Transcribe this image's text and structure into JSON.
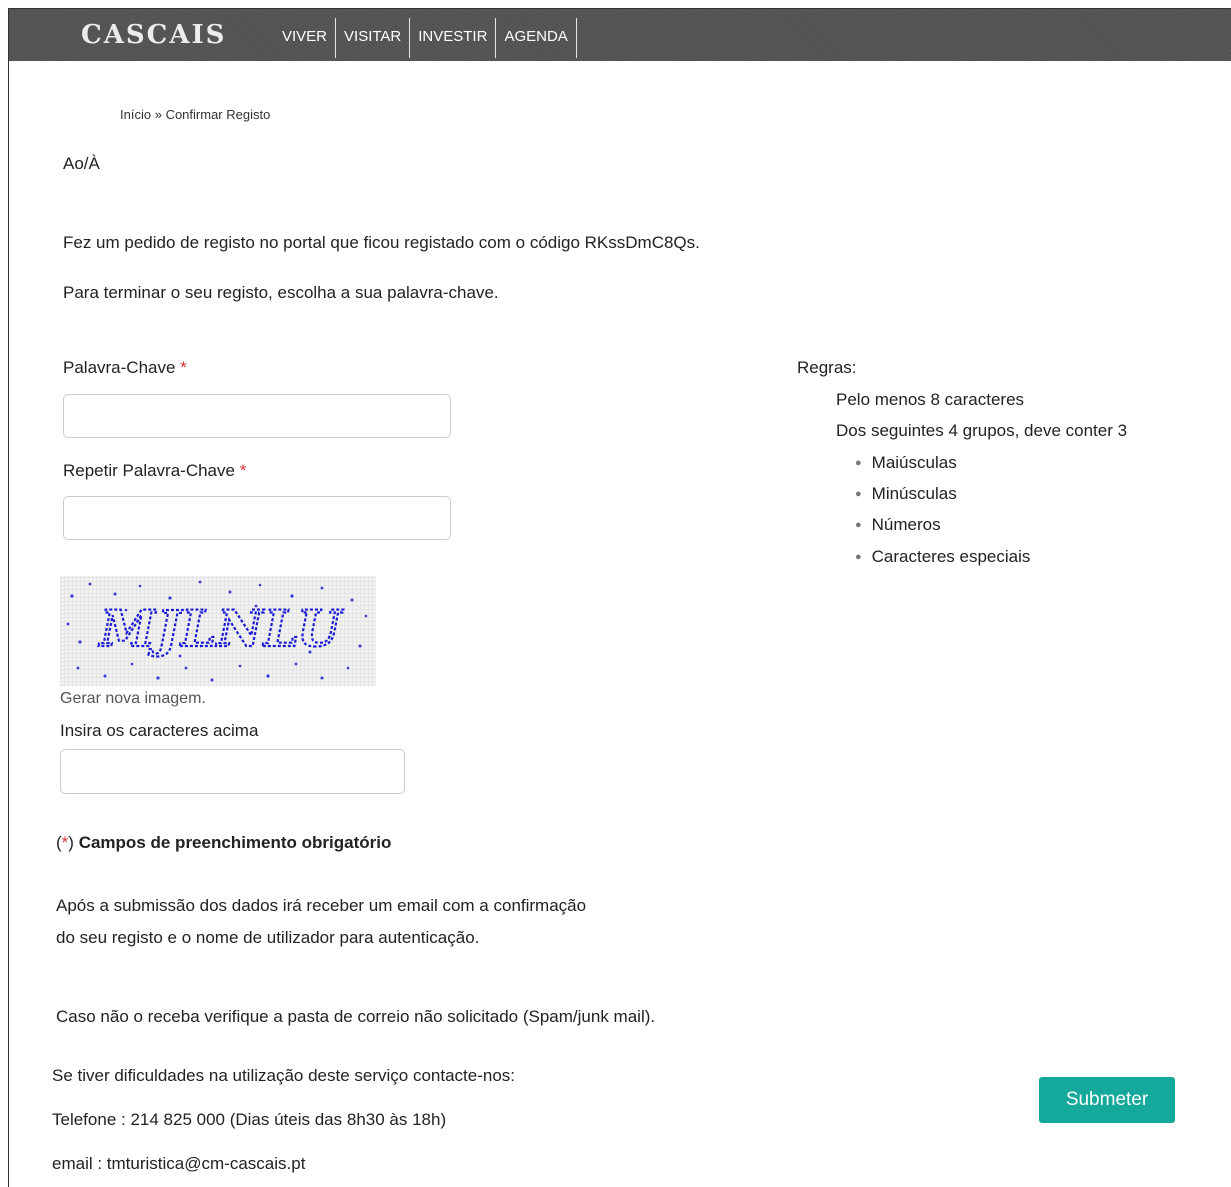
{
  "header": {
    "logo": "CASCAIS",
    "nav": [
      "VIVER",
      "VISITAR",
      "INVESTIR",
      "AGENDA"
    ]
  },
  "breadcrumb": {
    "home": "Início",
    "separator": "»",
    "current": "Confirmar Registo"
  },
  "intro": {
    "greeting": "Ao/À",
    "line1": "Fez um pedido de registo no portal que ficou registado com o código RKssDmC8Qs.",
    "line2": "Para terminar o seu registo, escolha a sua palavra-chave."
  },
  "form": {
    "password_label": "Palavra-Chave",
    "password_value": "",
    "repeat_label": "Repetir Palavra-Chave",
    "repeat_value": "",
    "required_mark": "*",
    "captcha_text": "MJLNLU",
    "captcha_refresh": "Gerar nova imagem.",
    "captcha_label": "Insira os caracteres acima",
    "captcha_value": ""
  },
  "rules": {
    "title": "Regras:",
    "items": [
      "Pelo menos 8 caracteres",
      "Dos seguintes 4 grupos, deve conter 3"
    ],
    "groups": [
      "Maiúsculas",
      "Minúsculas",
      "Números",
      "Caracteres especiais"
    ]
  },
  "notes": {
    "mandatory_open": "(",
    "mandatory_mark": "*",
    "mandatory_close": ")",
    "mandatory_text": "Campos de preenchimento obrigatório",
    "after_line1": "Após a submissão dos dados irá receber um email com a confirmação",
    "after_line2": "do seu registo e o nome de utilizador para autenticação.",
    "spam": "Caso não o receba verifique a pasta de correio não solicitado (Spam/junk mail)."
  },
  "contact": {
    "help": "Se tiver dificuldades na utilização deste serviço contacte-nos:",
    "phone": "Telefone : 214 825 000 (Dias úteis das 8h30 às 18h)",
    "email": "email : tmturistica@cm-cascais.pt"
  },
  "actions": {
    "submit": "Submeter"
  },
  "colors": {
    "topbar": "#555555",
    "required": "#dd3333",
    "submit": "#15a99b",
    "captcha_ink": "#1a1ad6"
  }
}
